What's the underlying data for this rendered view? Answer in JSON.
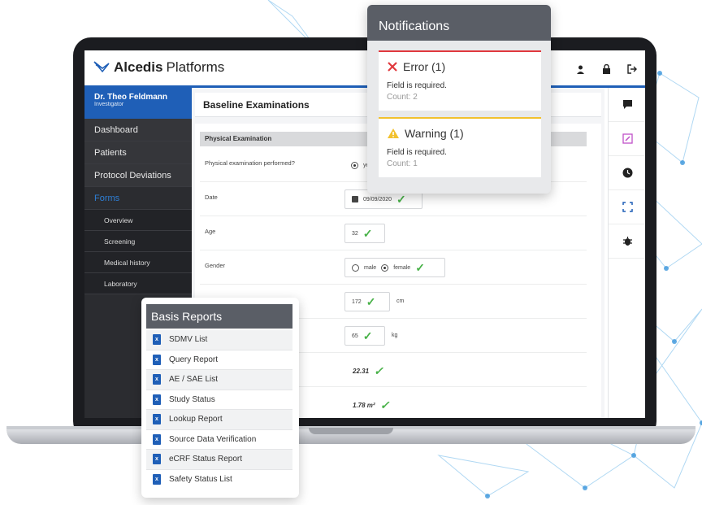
{
  "app": {
    "logo_bold": "Alcedis",
    "logo_light": "Platforms",
    "brand_color": "#1f5fb7",
    "header_icons": [
      "arrows-icon",
      "user-icon",
      "lock-icon",
      "logout-icon"
    ]
  },
  "user": {
    "name": "Dr. Theo Feldmann",
    "role": "Investigator"
  },
  "sidebar": {
    "items": [
      {
        "label": "Dashboard"
      },
      {
        "label": "Patients"
      },
      {
        "label": "Protocol Deviations"
      },
      {
        "label": "Forms"
      }
    ],
    "sub_items": [
      {
        "label": "Overview"
      },
      {
        "label": "Screening"
      },
      {
        "label": "Medical history"
      },
      {
        "label": "Laboratory"
      }
    ]
  },
  "main": {
    "title": "Baseline Examinations",
    "section": "Physical Examination",
    "rows": {
      "performed": {
        "label": "Physical examination performed?",
        "option": "ye"
      },
      "date": {
        "label": "Date",
        "value": "09/09/2020"
      },
      "age": {
        "label": "Age",
        "value": "32"
      },
      "gender": {
        "label": "Gender",
        "option_male": "male",
        "option_female": "female"
      },
      "height": {
        "value": "172",
        "unit": "cm"
      },
      "weight": {
        "value": "65",
        "unit": "kg"
      },
      "bmi": {
        "value": "22.31"
      },
      "bsa": {
        "value": "1.78 m²"
      }
    }
  },
  "right_toolbar": [
    "comment-icon",
    "edit-icon",
    "clock-icon",
    "fullscreen-icon",
    "bug-icon"
  ],
  "notifications": {
    "title": "Notifications",
    "error": {
      "title": "Error (1)",
      "message": "Field is required.",
      "count": "Count: 2",
      "color": "#e0393e"
    },
    "warning": {
      "title": "Warning (1)",
      "message": "Field is required.",
      "count": "Count: 1",
      "color": "#f2c12e"
    }
  },
  "reports": {
    "title": "Basis Reports",
    "items": [
      {
        "label": "SDMV List"
      },
      {
        "label": "Query Report"
      },
      {
        "label": "AE / SAE List"
      },
      {
        "label": "Study Status"
      },
      {
        "label": "Lookup Report"
      },
      {
        "label": "Source Data Verification"
      },
      {
        "label": "eCRF Status Report"
      },
      {
        "label": "Safety Status List"
      }
    ]
  }
}
